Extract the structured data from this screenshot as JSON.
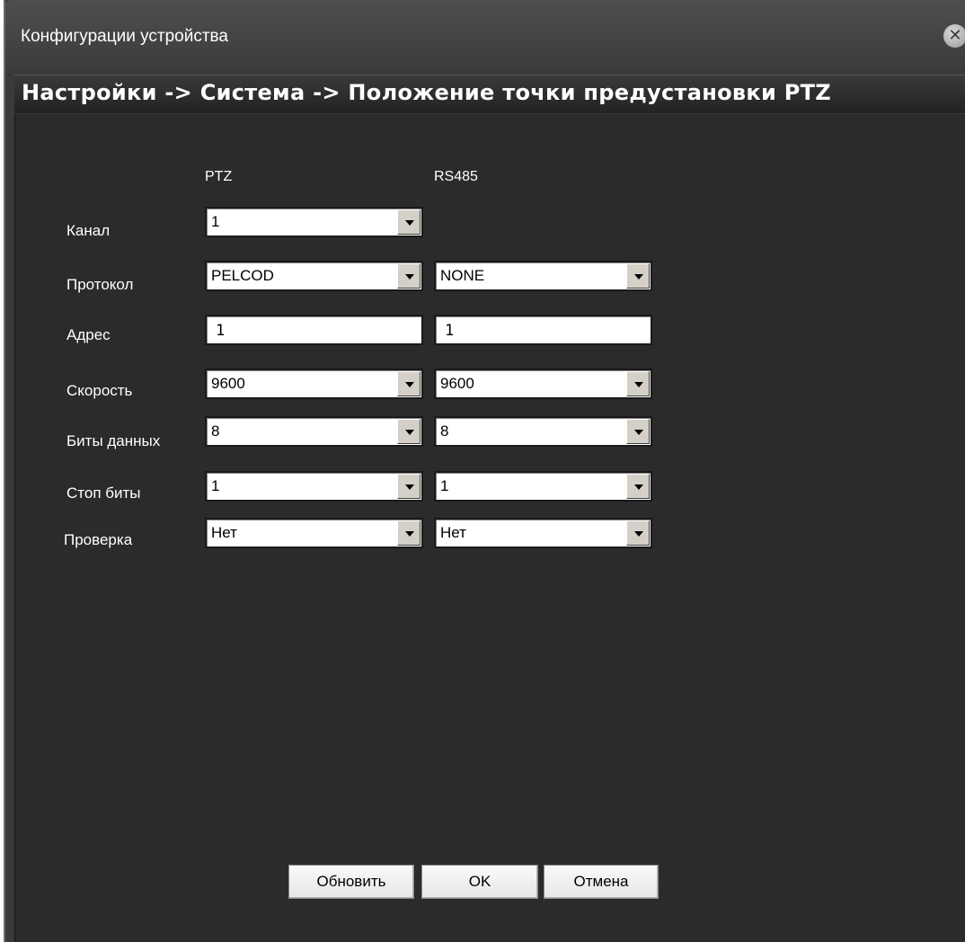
{
  "window": {
    "title": "Конфигурации устройства",
    "close_glyph": "✕"
  },
  "breadcrumb": "Настройки -> Система -> Положение точки предустановки PTZ",
  "columns": {
    "ptz": "PTZ",
    "rs485": "RS485"
  },
  "rows": {
    "channel": {
      "label": "Канал",
      "ptz": "1"
    },
    "protocol": {
      "label": "Протокол",
      "ptz": "PELCOD",
      "rs485": "NONE"
    },
    "address": {
      "label": "Адрес",
      "ptz": "1",
      "rs485": "1"
    },
    "speed": {
      "label": "Скорость",
      "ptz": "9600",
      "rs485": "9600"
    },
    "databits": {
      "label": "Биты данных",
      "ptz": "8",
      "rs485": "8"
    },
    "stopbits": {
      "label": "Стоп биты",
      "ptz": "1",
      "rs485": "1"
    },
    "parity": {
      "label": "Проверка",
      "ptz": "Нет",
      "rs485": "Нет"
    }
  },
  "buttons": {
    "refresh": "Обновить",
    "ok": "OK",
    "cancel": "Отмена"
  },
  "icons": {
    "close": "close-icon",
    "dropdown": "chevron-down-icon"
  }
}
